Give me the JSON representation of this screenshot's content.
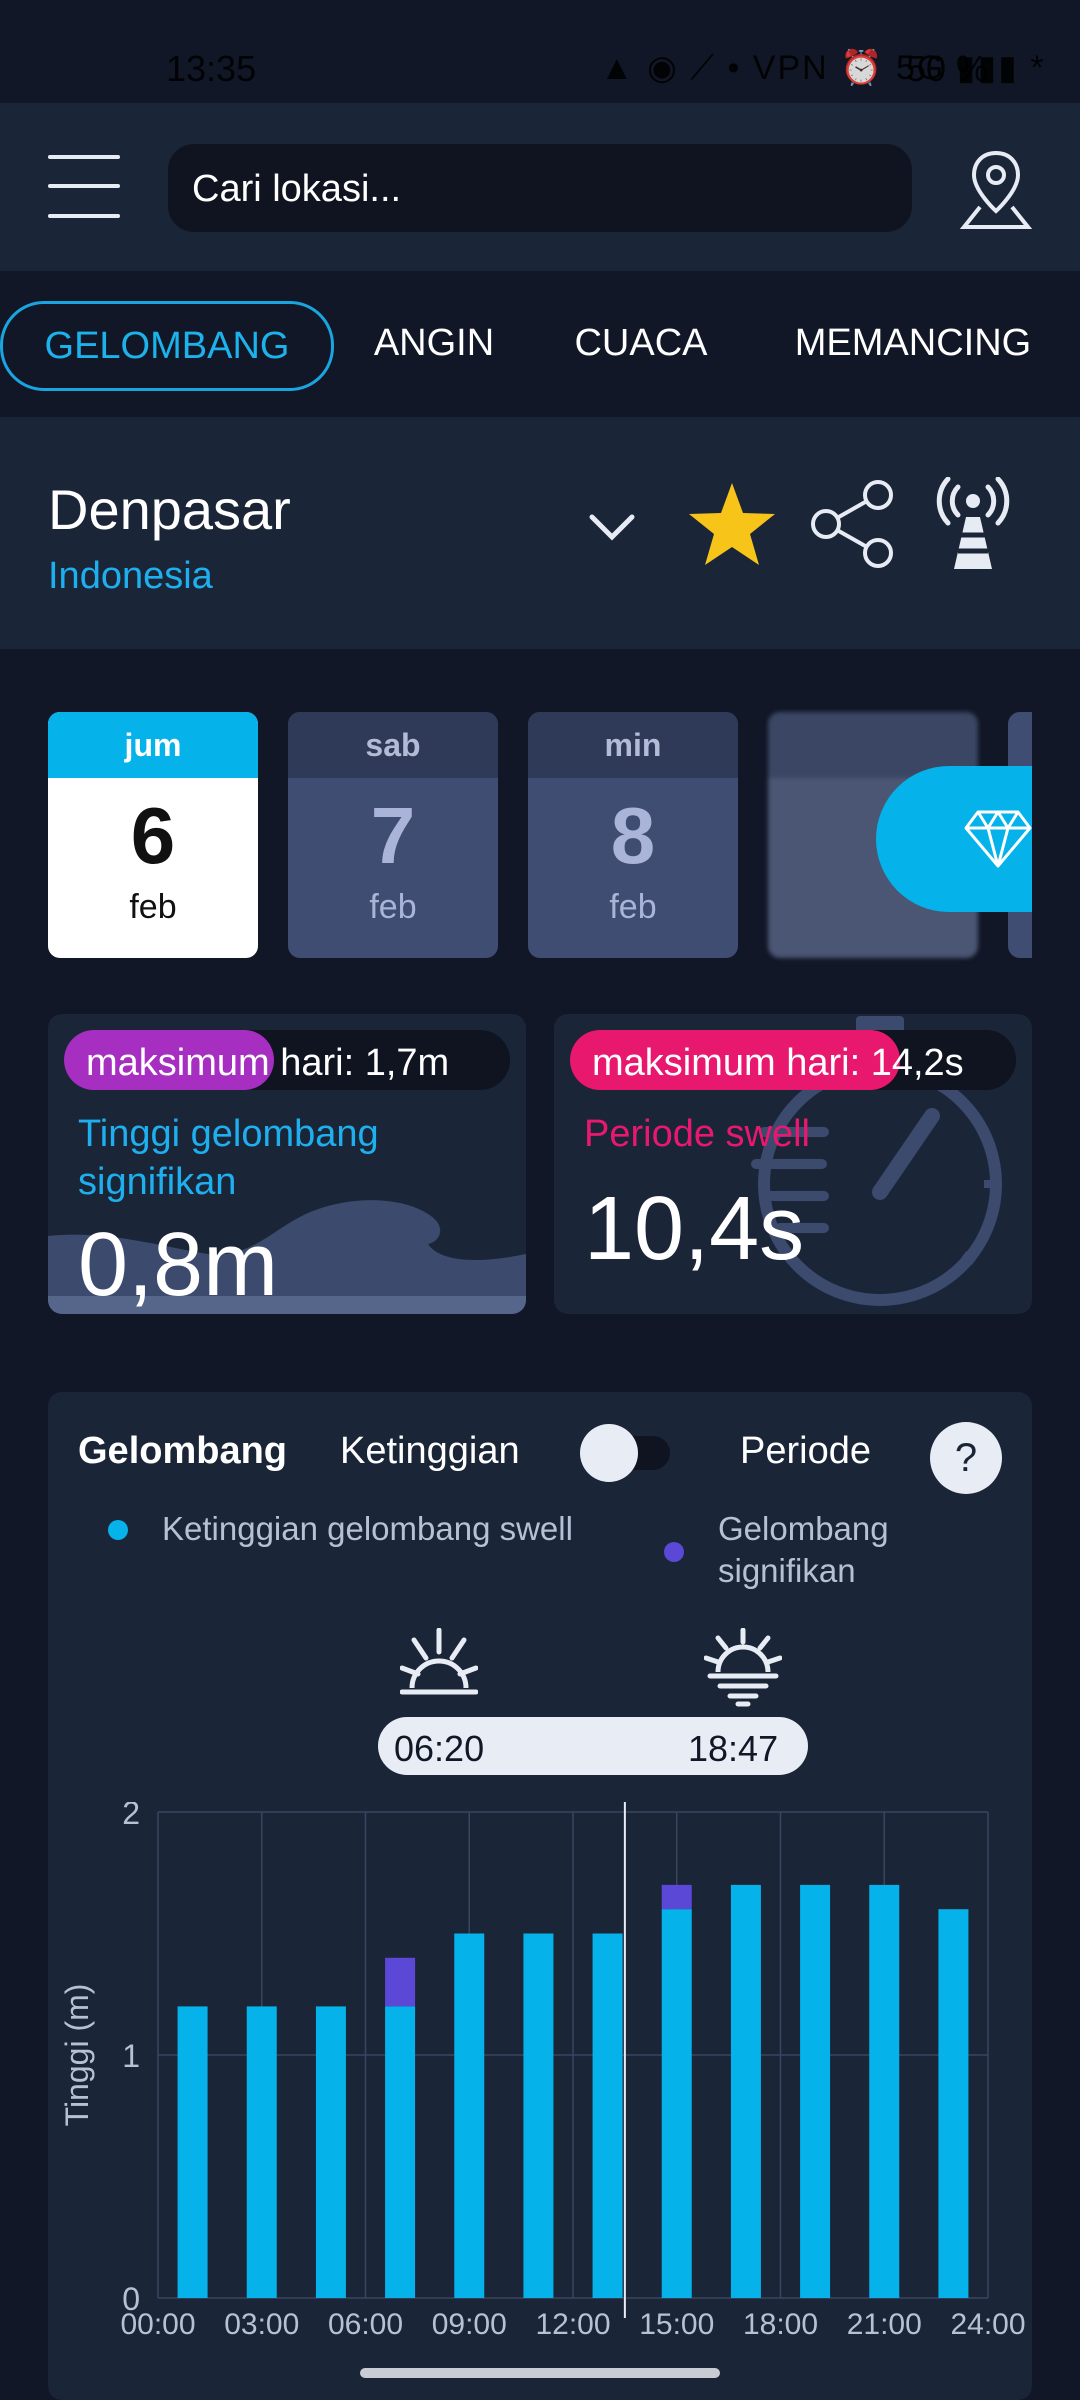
{
  "status_bar": {
    "time": "13:35",
    "battery": "50 %",
    "indicators": "▲ ◉ ⟋ • VPN ⏰ 5G ▮▮▮ *"
  },
  "header": {
    "search_placeholder": "Cari lokasi..."
  },
  "tabs": [
    {
      "label": "GELOMBANG",
      "active": true
    },
    {
      "label": "ANGIN",
      "active": false
    },
    {
      "label": "CUACA",
      "active": false
    },
    {
      "label": "MEMANCING",
      "active": false
    }
  ],
  "location": {
    "city": "Denpasar",
    "country": "Indonesia"
  },
  "days": [
    {
      "name": "jum",
      "num": "6",
      "month": "feb",
      "selected": true
    },
    {
      "name": "sab",
      "num": "7",
      "month": "feb",
      "selected": false
    },
    {
      "name": "min",
      "num": "8",
      "month": "feb",
      "selected": false
    }
  ],
  "wave_card": {
    "max_label": "maksimum hari: 1,7m",
    "title_line1": "Tinggi gelombang",
    "title_line2": "signifikan",
    "value": "0,8m"
  },
  "period_card": {
    "max_label": "maksimum hari: 14,2s",
    "title": "Periode swell",
    "value": "10,4s"
  },
  "chart_panel": {
    "title": "Gelombang",
    "toggle_left": "Ketinggian",
    "toggle_right": "Periode",
    "help": "?",
    "legend_swell": "Ketinggian gelombang swell",
    "legend_sig_line1": "Gelombang",
    "legend_sig_line2": "signifikan",
    "sunrise": "06:20",
    "sunset": "18:47"
  },
  "colors": {
    "swell": "#05b2ea",
    "significant": "#5b48d6",
    "accent": "#19a6e0",
    "star": "#f7c41a",
    "wave_pill": "#a62fc1",
    "period_pill": "#e8186f"
  },
  "chart_data": {
    "type": "bar",
    "ylabel": "Tinggi (m)",
    "ylim": [
      0,
      2
    ],
    "yticks": [
      "0",
      "1",
      "2"
    ],
    "xticks": [
      "00:00",
      "03:00",
      "06:00",
      "09:00",
      "12:00",
      "15:00",
      "18:00",
      "21:00",
      "24:00"
    ],
    "categories": [
      "01:30",
      "04:30",
      "07:30",
      "10:30",
      "13:30",
      "16:30",
      "19:30",
      "22:30",
      "01:30",
      "04:30",
      "07:30",
      "10:30"
    ],
    "series": [
      {
        "name": "Ketinggian gelombang swell",
        "values": [
          1.2,
          1.2,
          1.2,
          1.2,
          1.5,
          1.5,
          1.5,
          1.6,
          1.7,
          1.7,
          1.7,
          1.6
        ]
      },
      {
        "name": "Gelombang signifikan",
        "values": [
          1.2,
          1.2,
          1.2,
          1.4,
          1.5,
          1.5,
          1.5,
          1.7,
          1.7,
          1.7,
          1.7,
          1.6
        ]
      }
    ],
    "current_time_marker": "13:30"
  }
}
